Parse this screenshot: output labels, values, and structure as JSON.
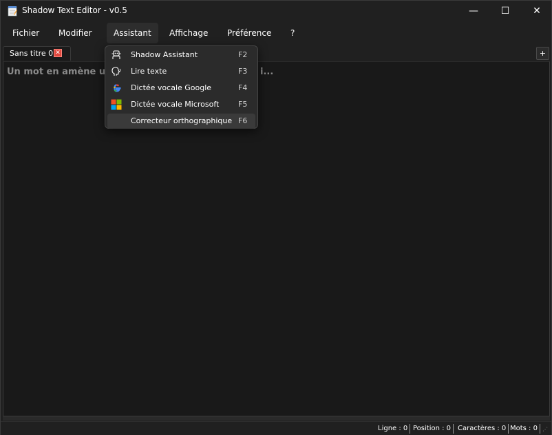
{
  "window": {
    "title": "Shadow Text Editor - v0.5",
    "controls": {
      "minimize": "—",
      "maximize": "☐",
      "close": "✕"
    }
  },
  "menu": {
    "items": [
      "Fichier",
      "Modifier",
      "Assistant",
      "Affichage",
      "Préférence",
      "?"
    ],
    "active": "Assistant"
  },
  "tabs": {
    "items": [
      {
        "label": "Sans titre 0",
        "close": "✕"
      }
    ],
    "add_label": "+"
  },
  "editor": {
    "placeholder_left": "Un mot en amène un",
    "placeholder_right": "i..."
  },
  "assistant_menu": {
    "items": [
      {
        "icon": "robot-icon",
        "label": "Shadow Assistant",
        "shortcut": "F2"
      },
      {
        "icon": "speaking-head-icon",
        "label": "Lire texte",
        "shortcut": "F3"
      },
      {
        "icon": "google-icon",
        "label": "Dictée vocale Google",
        "shortcut": "F4"
      },
      {
        "icon": "microsoft-icon",
        "label": "Dictée vocale Microsoft",
        "shortcut": "F5"
      },
      {
        "icon": "",
        "label": "Correcteur orthographique",
        "shortcut": "F6"
      }
    ]
  },
  "status": {
    "line": "Ligne : 0",
    "position": "Position : 0",
    "chars": "Caractères : 0",
    "words": "Mots : 0",
    "grip": "⋰"
  },
  "colors": {
    "background": "#202020",
    "editor": "#191919",
    "menu_bg": "#2b2b2b",
    "tab_close": "#e0483e"
  }
}
